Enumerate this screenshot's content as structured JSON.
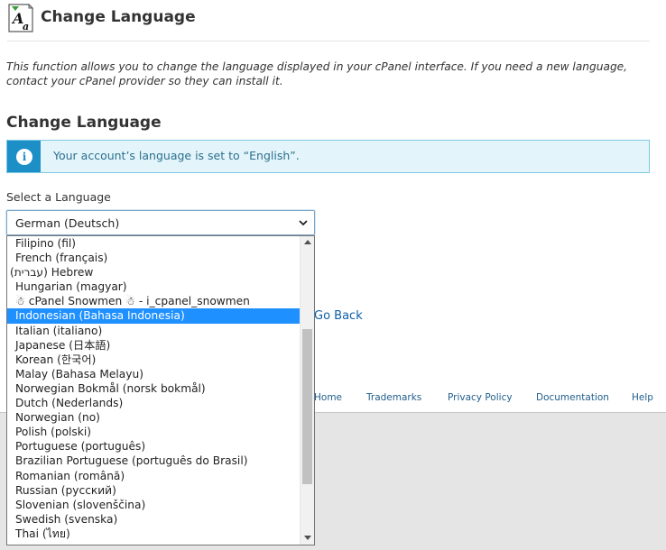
{
  "header": {
    "title": "Change Language",
    "logo_icon": "change-language-icon"
  },
  "description": "This function allows you to change the language displayed in your cPanel interface. If you need a new language, contact your cPanel provider so they can install it.",
  "section_title": "Change Language",
  "alert": {
    "icon": "info-icon",
    "text": "Your account’s language is set to “English”."
  },
  "language_select": {
    "label": "Select a Language",
    "selected_value": "German (Deutsch)",
    "options": [
      "Filipino (fil)",
      "French (français)",
      "(עברית) Hebrew",
      "Hungarian (magyar)",
      "☃ cPanel Snowmen ☃ - i_cpanel_snowmen",
      "Indonesian (Bahasa Indonesia)",
      "Italian (italiano)",
      "Japanese (日本語)",
      "Korean (한국어)",
      "Malay (Bahasa Melayu)",
      "Norwegian Bokmål (norsk bokmål)",
      "Dutch (Nederlands)",
      "Norwegian (no)",
      "Polish (polski)",
      "Portuguese (português)",
      "Brazilian Portuguese (português do Brasil)",
      "Romanian (română)",
      "Russian (русский)",
      "Slovenian (slovenščina)",
      "Swedish (svenska)",
      "Thai (ไทย)"
    ],
    "highlighted_index": 5
  },
  "go_back": "Go Back",
  "footer": {
    "home": "Home",
    "trademarks": "Trademarks",
    "privacy_policy": "Privacy Policy",
    "documentation": "Documentation",
    "help": "Help"
  },
  "colors": {
    "accent": "#1c8fc7",
    "alert_bg": "#e3f5fb",
    "highlight": "#1e90ff",
    "link": "#0c5fa8"
  }
}
